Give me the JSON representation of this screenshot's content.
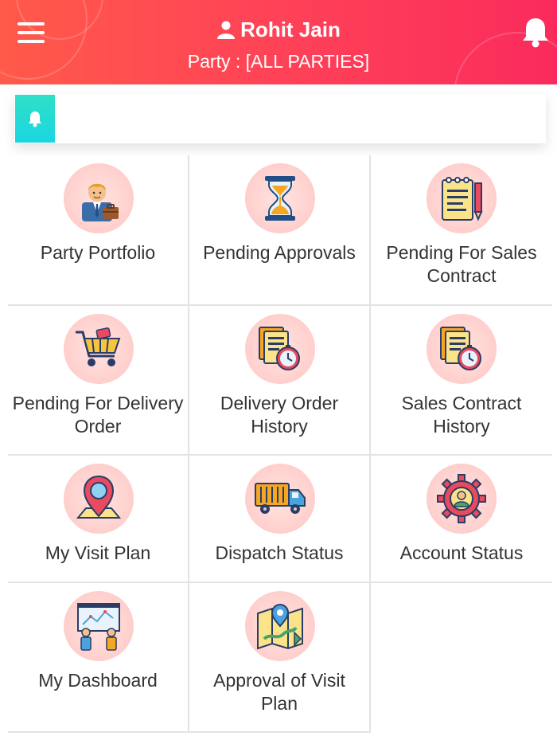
{
  "header": {
    "user_name": "Rohit Jain",
    "party_label": "Party : [ALL PARTIES]",
    "menu_icon": "hamburger-menu-icon",
    "notification_icon": "bell-icon",
    "gradient_start": "#ff5a4a",
    "gradient_end": "#fa2b5c"
  },
  "notification_card": {
    "icon": "bell-icon",
    "text": "",
    "accent": "#1ad6e0"
  },
  "tiles": [
    {
      "label": "Party Portfolio",
      "icon": "businessman-icon"
    },
    {
      "label": "Pending Approvals",
      "icon": "hourglass-icon"
    },
    {
      "label": "Pending For Sales Contract",
      "icon": "notepad-pencil-icon"
    },
    {
      "label": "Pending For Delivery Order",
      "icon": "shopping-cart-icon"
    },
    {
      "label": "Delivery Order History",
      "icon": "documents-stopwatch-icon"
    },
    {
      "label": "Sales Contract History",
      "icon": "documents-stopwatch-icon"
    },
    {
      "label": "My Visit Plan",
      "icon": "map-pin-icon"
    },
    {
      "label": "Dispatch Status",
      "icon": "delivery-truck-icon"
    },
    {
      "label": "Account Status",
      "icon": "account-gear-icon"
    },
    {
      "label": "My Dashboard",
      "icon": "presentation-board-icon"
    },
    {
      "label": "Approval of Visit Plan",
      "icon": "route-map-icon"
    }
  ]
}
